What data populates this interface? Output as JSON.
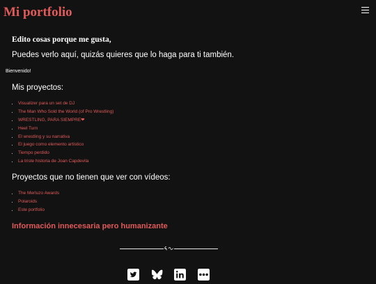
{
  "header": {
    "site_title": "Mi portfolio",
    "menu_icon": "hamburger-menu-icon"
  },
  "intro": {
    "tagline": "Edito cosas porque me gusta,",
    "subtagline": "Puedes verlo aquí, quizás quieres que lo haga para ti también.",
    "welcome": "Bienvenido!"
  },
  "projects": {
    "heading": "Mis proyectos:",
    "items": [
      {
        "label": "Visualizer para un set de DJ"
      },
      {
        "label": "The Man Who Sold the World (of Pro Wrestling)"
      },
      {
        "label": "WRESTLING, PARA SIEMPRE❤"
      },
      {
        "label": "Heel Turn"
      },
      {
        "label": "El wrestling y su narrativa"
      },
      {
        "label": "El juego como elemento artístico"
      },
      {
        "label": "Tiempo perdido"
      },
      {
        "label": "La triste historia de Joan Capdevila"
      }
    ]
  },
  "other_projects": {
    "heading": "Proyectos que no tienen que ver con vídeos:",
    "items": [
      {
        "label": "The Merluzo Awards"
      },
      {
        "label": "Polaroids"
      },
      {
        "label": "Este portfolio"
      }
    ]
  },
  "human_info_link": "Información innecesaria pero humanizante",
  "social": {
    "icons": [
      "twitter-icon",
      "bluesky-icon",
      "linkedin-icon",
      "flickr-icon"
    ]
  },
  "colors": {
    "background": "#121212",
    "accent": "#e05a59",
    "text": "#ffffff"
  }
}
